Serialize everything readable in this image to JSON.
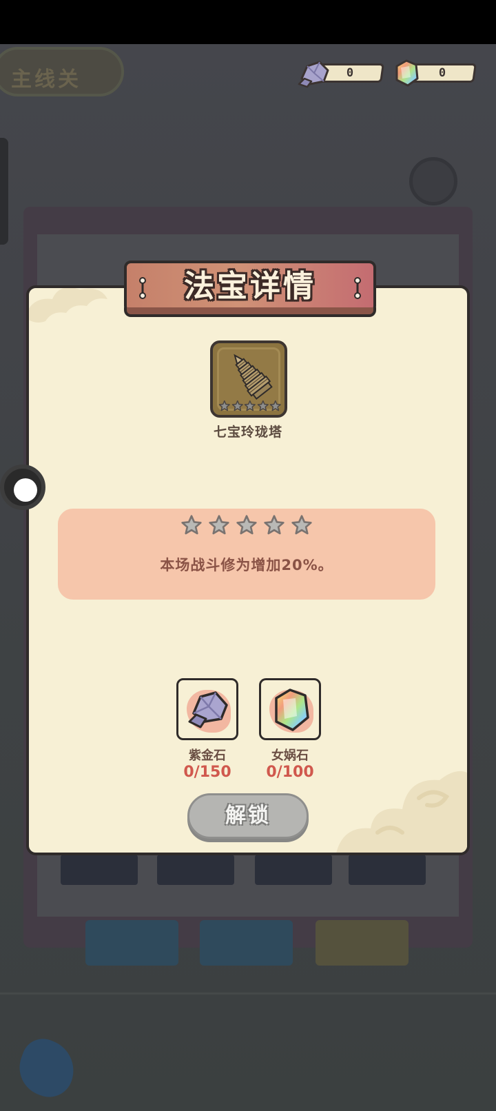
{
  "background": {
    "top_left_label": "主线关"
  },
  "resources": {
    "purple_gold_stone_count": "0",
    "nuwa_stone_count": "0"
  },
  "dialog": {
    "title": "法宝详情",
    "item": {
      "name": "七宝玲珑塔",
      "star_level": 0,
      "max_stars": 5,
      "icon": "pagoda-icon"
    },
    "description": "本场战斗修为增加20%。",
    "costs": [
      {
        "name": "紫金石",
        "count": "0/150",
        "icon": "purple-gold-stone-icon"
      },
      {
        "name": "女娲石",
        "count": "0/100",
        "icon": "nuwa-stone-icon"
      }
    ],
    "unlock_label": "解锁"
  },
  "colors": {
    "dialog_bg": "#f7f0d5",
    "banner": "#c5806a",
    "desc_panel": "#f6c6ab",
    "cost_count": "#d0584d",
    "unlock_button": "#b5b5b2"
  }
}
